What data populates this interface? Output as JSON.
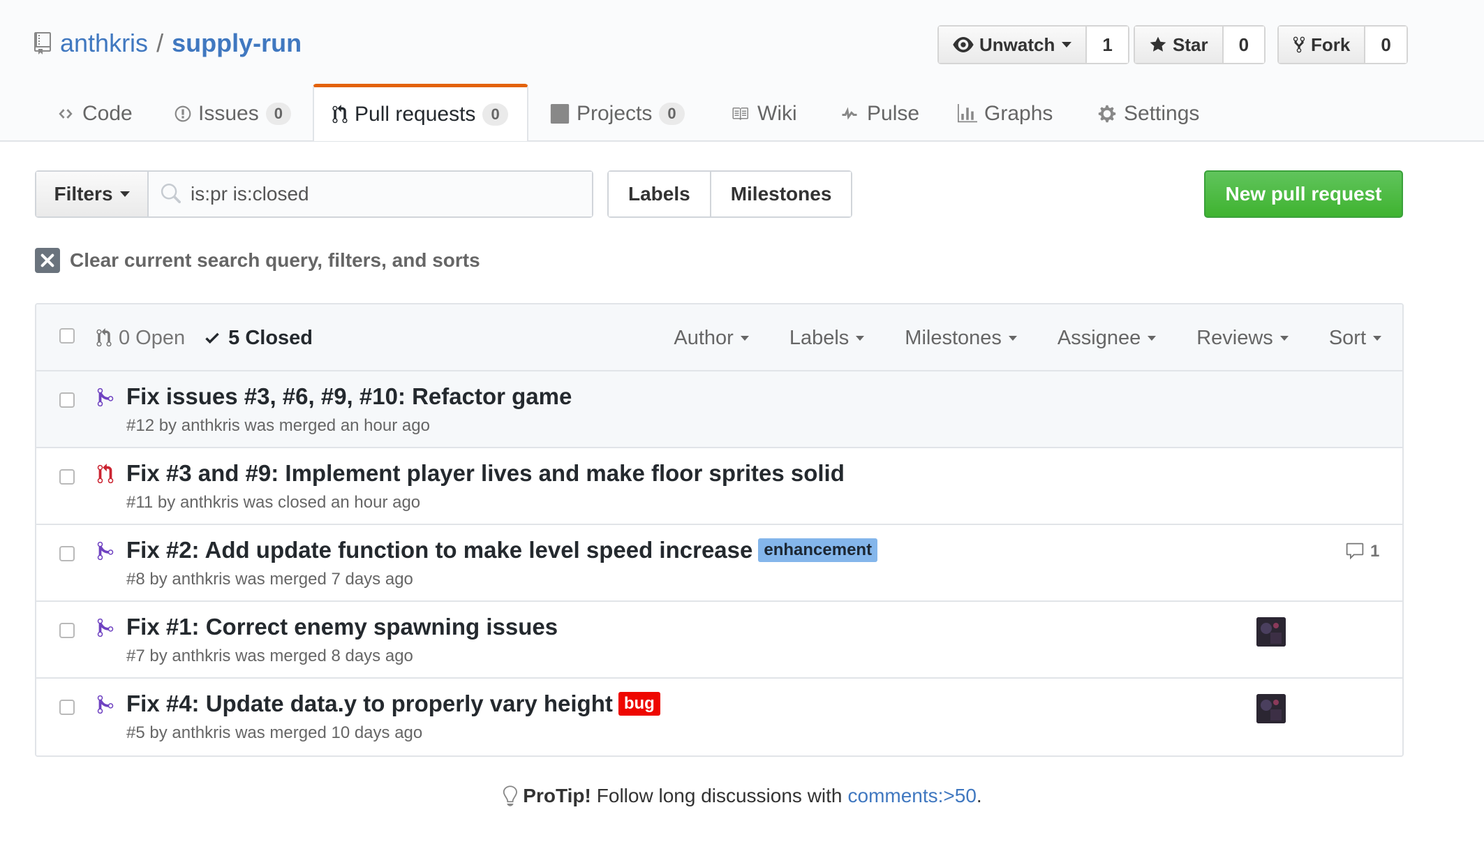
{
  "repo": {
    "owner": "anthkris",
    "separator": "/",
    "name": "supply-run"
  },
  "actions": {
    "watch": {
      "label": "Unwatch",
      "count": "1"
    },
    "star": {
      "label": "Star",
      "count": "0"
    },
    "fork": {
      "label": "Fork",
      "count": "0"
    }
  },
  "tabs": [
    {
      "label": "Code",
      "icon": "code-icon"
    },
    {
      "label": "Issues",
      "count": "0",
      "icon": "issue-icon"
    },
    {
      "label": "Pull requests",
      "count": "0",
      "icon": "pull-request-icon",
      "selected": true
    },
    {
      "label": "Projects",
      "count": "0",
      "icon": "project-icon"
    },
    {
      "label": "Wiki",
      "icon": "book-icon"
    },
    {
      "label": "Pulse",
      "icon": "pulse-icon"
    },
    {
      "label": "Graphs",
      "icon": "graph-icon"
    },
    {
      "label": "Settings",
      "icon": "gear-icon"
    }
  ],
  "filterbar": {
    "filters_label": "Filters",
    "search_value": "is:pr is:closed",
    "labels_label": "Labels",
    "milestones_label": "Milestones",
    "new_pr_label": "New pull request"
  },
  "clear_query": "Clear current search query, filters, and sorts",
  "list_header": {
    "open": "0 Open",
    "closed": "5 Closed",
    "filters": [
      "Author",
      "Labels",
      "Milestones",
      "Assignee",
      "Reviews",
      "Sort"
    ]
  },
  "pull_requests": [
    {
      "title": "Fix issues #3, #6, #9, #10: Refactor game",
      "meta": "#12 by anthkris was merged an hour ago",
      "state": "merged"
    },
    {
      "title": "Fix #3 and #9: Implement player lives and make floor sprites solid",
      "meta": "#11 by anthkris was closed an hour ago",
      "state": "closed"
    },
    {
      "title": "Fix #2: Add update function to make level speed increase",
      "meta": "#8 by anthkris was merged 7 days ago",
      "state": "merged",
      "label": {
        "text": "enhancement",
        "bg": "#84b6eb",
        "fg": "#1c2733"
      },
      "comments": "1"
    },
    {
      "title": "Fix #1: Correct enemy spawning issues",
      "meta": "#7 by anthkris was merged 8 days ago",
      "state": "merged",
      "avatar": true
    },
    {
      "title": "Fix #4: Update data.y to properly vary height",
      "meta": "#5 by anthkris was merged 10 days ago",
      "state": "merged",
      "label": {
        "text": "bug",
        "bg": "#ee0701",
        "fg": "#ffffff"
      },
      "avatar": true
    }
  ],
  "protip": {
    "strong": "ProTip!",
    "text": "Follow long discussions with",
    "link": "comments:>50",
    "end": "."
  },
  "colors": {
    "merged": "#6f42c1",
    "closed": "#cb2431",
    "link": "#4078c0",
    "accent_tab": "#e36209",
    "new_pr": "#3fb330"
  }
}
